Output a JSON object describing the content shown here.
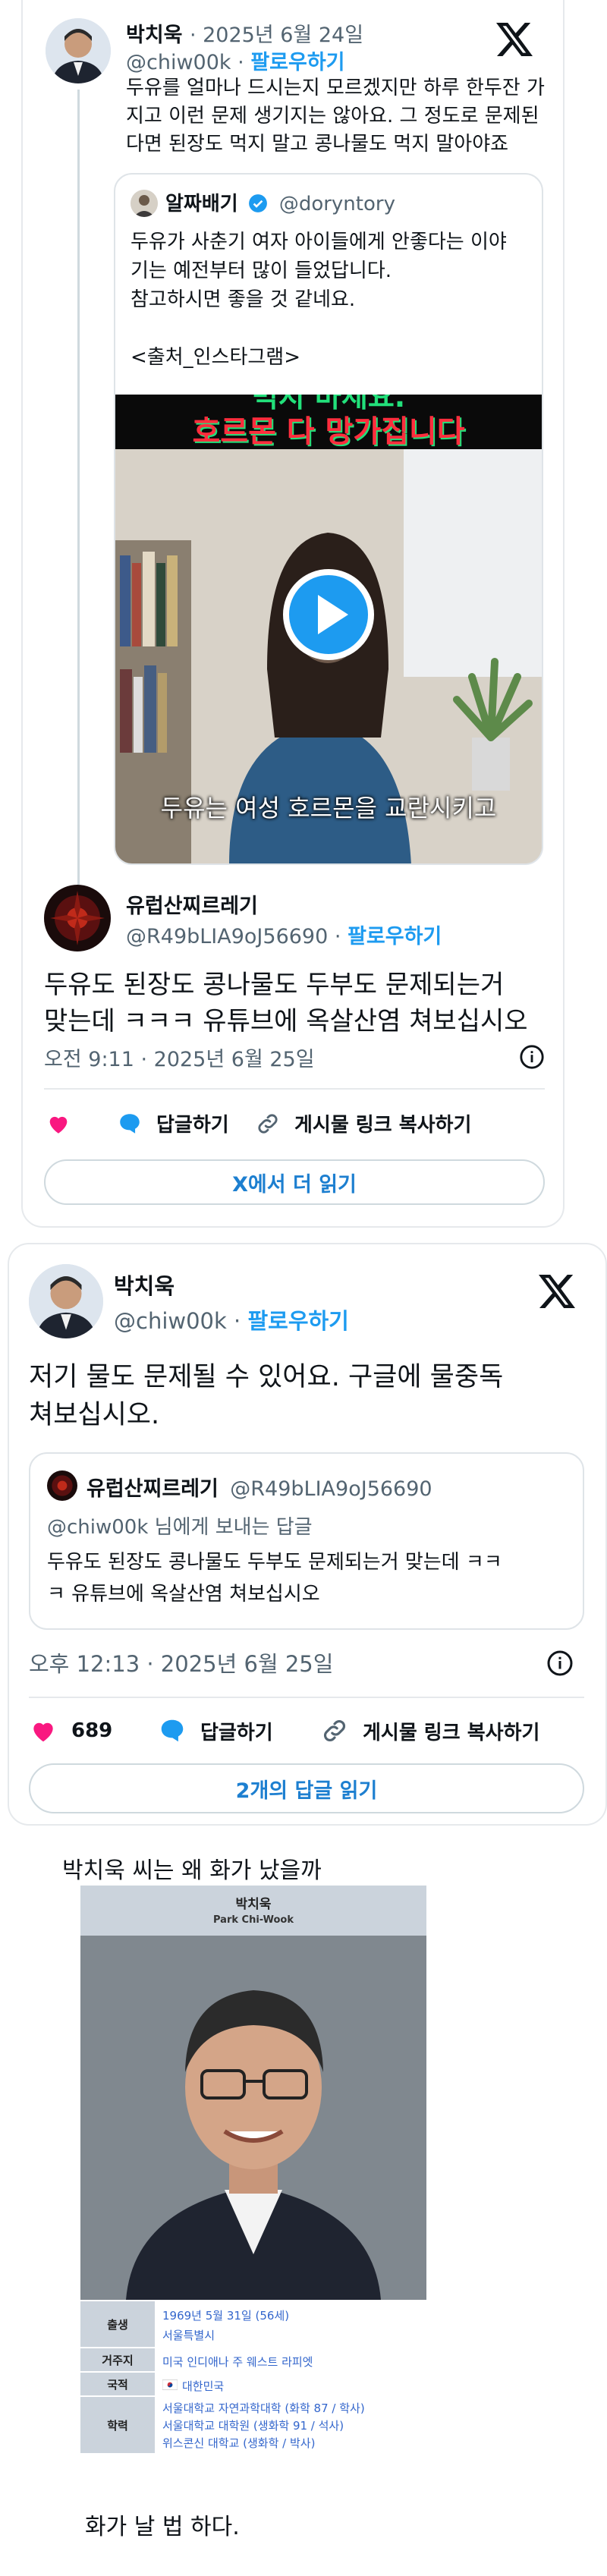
{
  "tweet1": {
    "author_name": "박치욱",
    "author_handle": "@chiw00k",
    "follow": "팔로우하기",
    "date": "2025년 6월 24일",
    "text_lines": [
      "두유를 얼마나 드시는지 모르겠지만 하루 한두잔 가",
      "지고 이런 문제 생기지는 않아요. 그 정도로 문제된",
      "다면 된장도 먹지 말고 콩나물도 먹지 말아야죠"
    ],
    "quote": {
      "name": "알짜배기",
      "handle": "@doryntory",
      "text_lines": [
        "두유가 사춘기 여자 아이들에게 안좋다는 이야",
        "기는 예전부터 많이 들었답니다.",
        "참고하시면 좋을 것 같네요.",
        "",
        "<출처_인스타그램>"
      ],
      "video_banner_top": "먹지 마세요.",
      "video_banner": "호르몬 다 망가집니다",
      "video_caption": "두유는 여성 호르몬을 교란시키고"
    },
    "reply": {
      "name": "유럽산찌르레기",
      "handle": "@R49bLIA9oJ56690",
      "follow": "팔로우하기",
      "text_lines": [
        "두유도 된장도 콩나물도 두부도 문제되는거",
        "맞는데 ㅋㅋㅋ 유튜브에 옥살산염 쳐보십시오"
      ],
      "timestamp": "오전 9:11 · 2025년 6월 25일"
    },
    "actions": {
      "reply": "답글하기",
      "copy": "게시물 링크 복사하기"
    },
    "read_more": "X에서 더 읽기"
  },
  "tweet2": {
    "author_name": "박치욱",
    "author_handle": "@chiw00k",
    "follow": "팔로우하기",
    "text_lines": [
      "저기 물도 문제될 수 있어요. 구글에 물중독",
      "쳐보십시오."
    ],
    "quote": {
      "name": "유럽산찌르레기",
      "handle": "@R49bLIA9oJ56690",
      "reply_to": "@chiw00k 님에게 보내는 답글",
      "text_lines": [
        "두유도 된장도 콩나물도 두부도 문제되는거 맞는데 ㅋㅋ",
        "ㅋ 유튜브에 옥살산염 쳐보십시오"
      ]
    },
    "timestamp": "오후 12:13 · 2025년 6월 25일",
    "likes": "689",
    "actions": {
      "reply": "답글하기",
      "copy": "게시물 링크 복사하기"
    },
    "read_replies": "2개의 답글 읽기"
  },
  "caption_top": "박치욱 씨는 왜 화가 났을까",
  "wiki": {
    "name_ko": "박치욱",
    "name_en": "Park Chi-Wook",
    "rows": [
      {
        "label": "출생",
        "values": [
          "1969년 5월 31일 (56세)",
          "서울특별시"
        ]
      },
      {
        "label": "거주지",
        "values": [
          "미국 인디애나 주 웨스트 라피엣"
        ]
      },
      {
        "label": "국적",
        "values": [
          "대한민국"
        ]
      },
      {
        "label": "학력",
        "values": [
          "서울대학교 자연과학대학 (화학 87 / 학사)",
          "서울대학교 대학원 (생화학 91 / 석사)",
          "위스콘신 대학교 (생화학 / 박사)"
        ]
      }
    ]
  },
  "caption_bottom": "화가 날 법 하다.",
  "colors": {
    "link_blue": "#1d9bf0",
    "heart_red": "#f91880",
    "banner_green": "#22e07a",
    "banner_red": "#ff2d3d"
  }
}
